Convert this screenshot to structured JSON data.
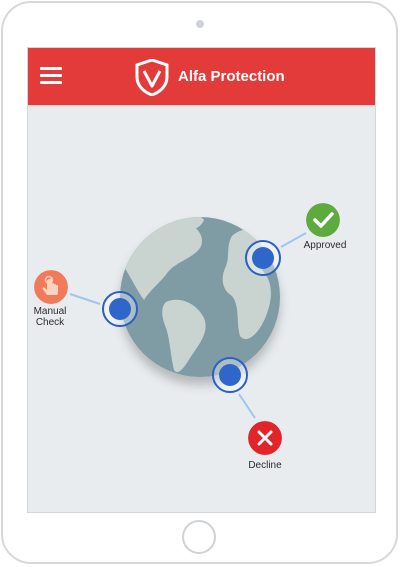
{
  "app": {
    "title": "Alfa Protection",
    "menu_icon": "hamburger-menu-icon",
    "logo_icon": "shield-v-logo-icon"
  },
  "statuses": {
    "approved": {
      "label": "Approved",
      "icon": "check-icon",
      "color": "#5dab3f"
    },
    "manual": {
      "label_line1": "Manual",
      "label_line2": "Check",
      "icon": "hand-pointer-icon",
      "color": "#f07a5a"
    },
    "decline": {
      "label": "Decline",
      "icon": "close-x-icon",
      "color": "#e2242b"
    }
  },
  "colors": {
    "brand": "#e33a3a",
    "globe_ocean": "#7f9ba3",
    "globe_land": "#c9d4d1",
    "marker": "#2e66c9",
    "connector": "#9ec6ec"
  }
}
